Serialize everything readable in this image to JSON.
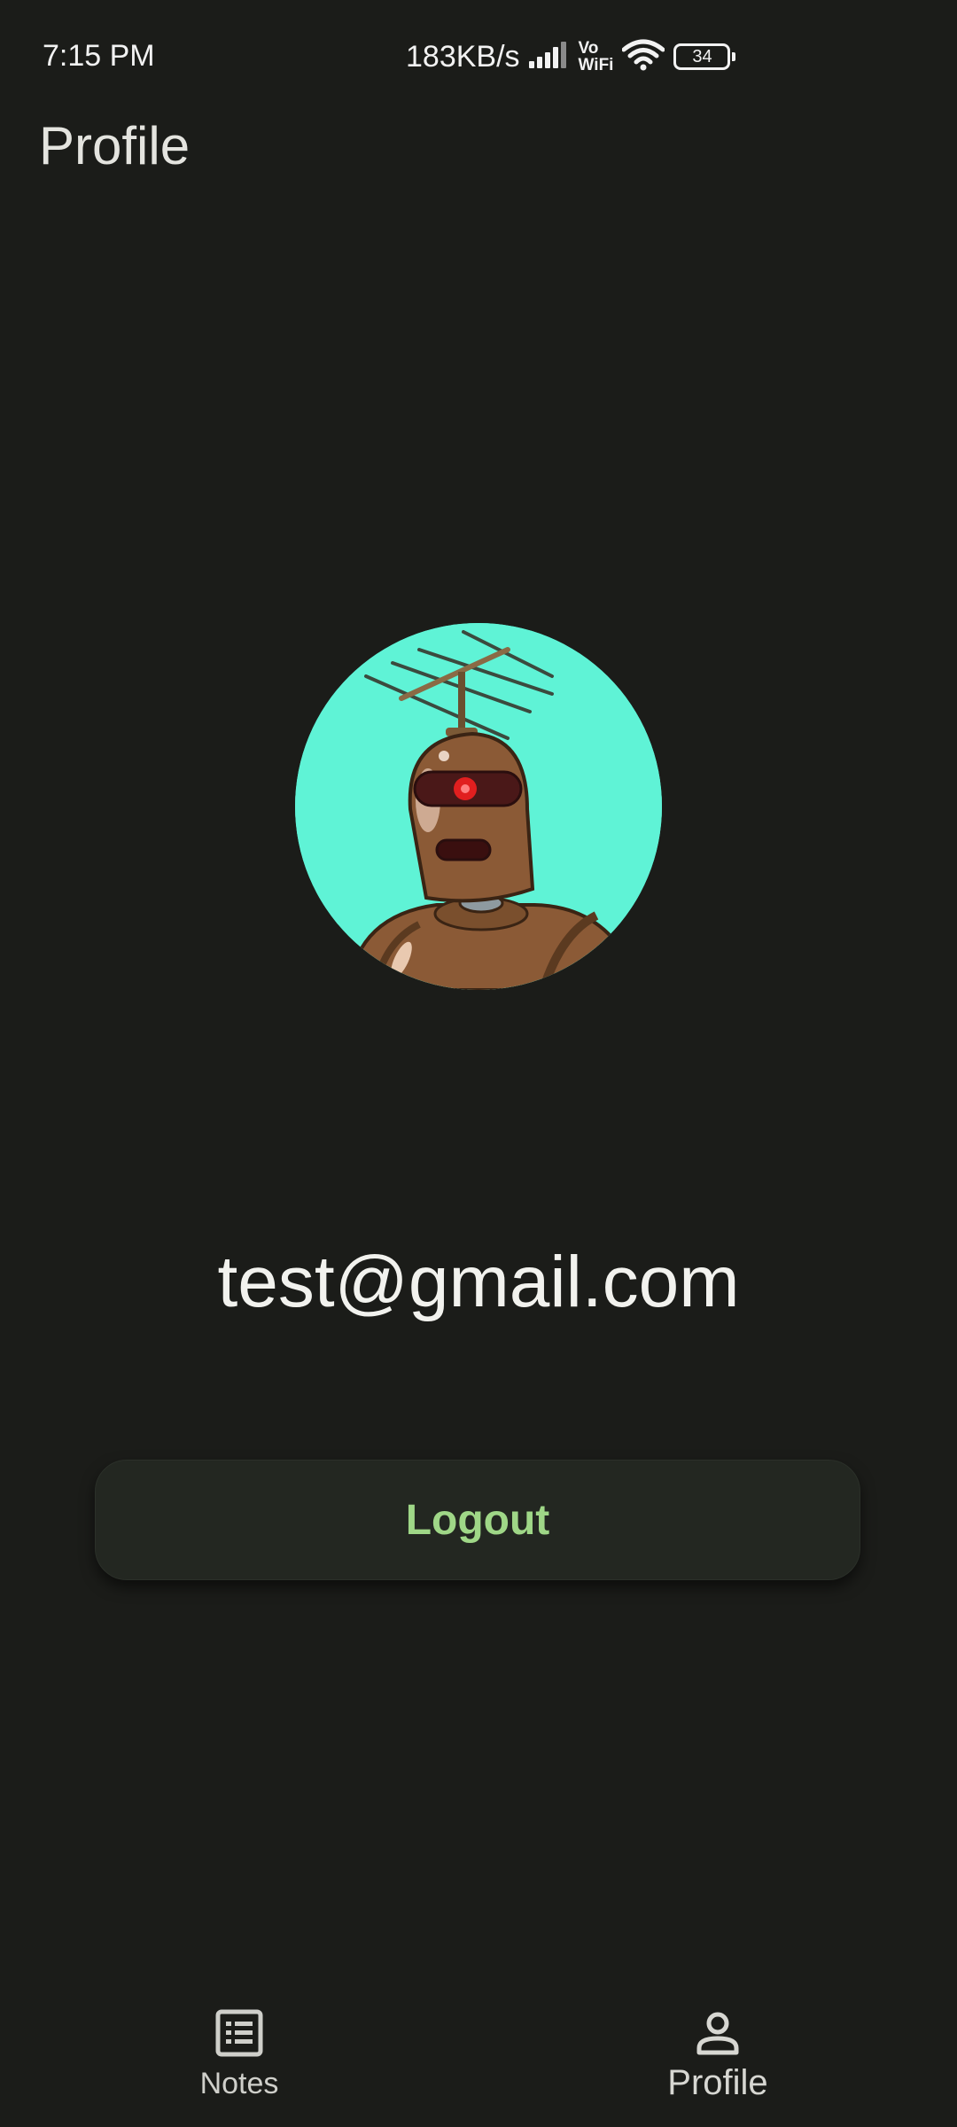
{
  "status_bar": {
    "time": "7:15 PM",
    "net_speed": "183KB/s",
    "vowifi_top": "Vo",
    "vowifi_bottom": "WiFi",
    "battery_level": "34",
    "icons": [
      "signal-icon",
      "vowifi-icon",
      "wifi-icon",
      "battery-icon"
    ]
  },
  "app_bar": {
    "title": "Profile"
  },
  "profile": {
    "avatar_icon": "robot-avatar",
    "avatar_background": "#5ff3d6",
    "email": "test@gmail.com",
    "logout_label": "Logout"
  },
  "bottom_nav": {
    "items": [
      {
        "label": "Notes",
        "icon": "notes-list-icon",
        "selected": false
      },
      {
        "label": "Profile",
        "icon": "person-icon",
        "selected": true
      }
    ]
  },
  "colors": {
    "background": "#1b1c19",
    "accent": "#9fd787",
    "button_surface": "#232721"
  }
}
